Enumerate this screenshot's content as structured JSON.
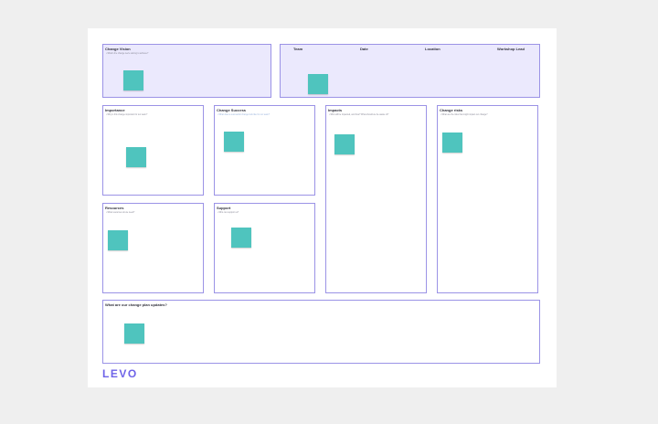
{
  "panels": {
    "change_vision": {
      "title": "Change Vision",
      "subtitle": "• What's the change we're aiming to achieve?"
    },
    "header_row": {
      "columns": [
        "Team",
        "Date",
        "Location",
        "Workshop Lead"
      ]
    },
    "importance": {
      "title": "Importance",
      "subtitle": "• Why is this change important for our team?"
    },
    "change_success": {
      "title": "Change Success",
      "subtitle": "• What does a successful change look like for our team?"
    },
    "impacts": {
      "title": "Impacts",
      "subtitle": "• Who will be impacted, and how? What should we be aware of?"
    },
    "change_risks": {
      "title": "Change risks",
      "subtitle": "• What are the risks that might impact our change?"
    },
    "resources": {
      "title": "Resources",
      "subtitle": "• What resources do we need?"
    },
    "support": {
      "title": "Support",
      "subtitle": "• Who can support us?"
    },
    "updates": {
      "title": "What are our change plan updates?"
    }
  },
  "brand": {
    "logo": "LEVO",
    "accent": "#6e63e8",
    "sticky_color": "#4fc4be",
    "border_color": "#9b93e6"
  }
}
